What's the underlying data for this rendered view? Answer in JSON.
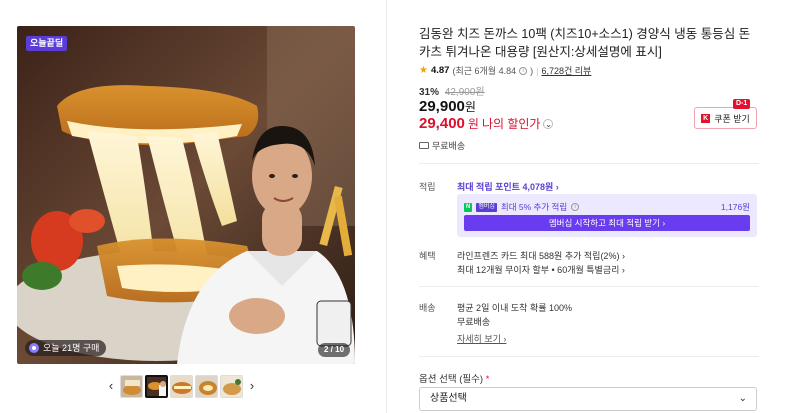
{
  "gallery": {
    "badge": "오늘끝딜",
    "purchase_text": "오늘 21명 구매",
    "counter": "2 / 10",
    "prev_arrow": "‹",
    "next_arrow": "›"
  },
  "product": {
    "title": "김동완 치즈 돈까스 10팩 (치즈10+소스1) 경양식 냉동 통등심 돈카츠 튀겨나온 대용량 [원산지:상세설명에 표시]",
    "rating_star": "★",
    "rating": "4.87",
    "rating_recent": "(최근 6개월 4.84",
    "reviews": "6,728건 리뷰",
    "discount_rate": "31%",
    "original_price": "42,900원",
    "price": "29,900",
    "price_unit": "원",
    "my_price": "29,400",
    "my_price_unit": "원",
    "my_price_label": "나의 할인가",
    "coupon_button": "쿠폰 받기",
    "coupon_tag": "D-1",
    "free_shipping": "무료배송"
  },
  "points": {
    "label": "적립",
    "max_point": "최대 적립 포인트 4,078원 ›",
    "membership_line": "최대 5% 추가 적립",
    "membership_amount": "1,176원",
    "n_icon": "N",
    "m_icon": "멤버십",
    "cta": "멤버십 시작하고 최대 적립 받기 ›"
  },
  "benefits": {
    "label": "혜택",
    "line1": "라인프렌즈 카드 최대 588원 추가 적립(2%) ›",
    "line2": "최대 12개월 무이자 할부 • 60개월 특별금리 ›"
  },
  "delivery": {
    "label": "배송",
    "line1": "평균 2일 이내 도착 확률 100%",
    "line2": "무료배송",
    "detail": "자세히 보기 ›"
  },
  "options": {
    "label": "옵션 선택 (필수)",
    "required_mark": "*",
    "select_value": "상품선택"
  },
  "colors": {
    "accent": "#5a3cd6",
    "price_red": "#d9102e",
    "membership_bg": "#ece9fe"
  }
}
